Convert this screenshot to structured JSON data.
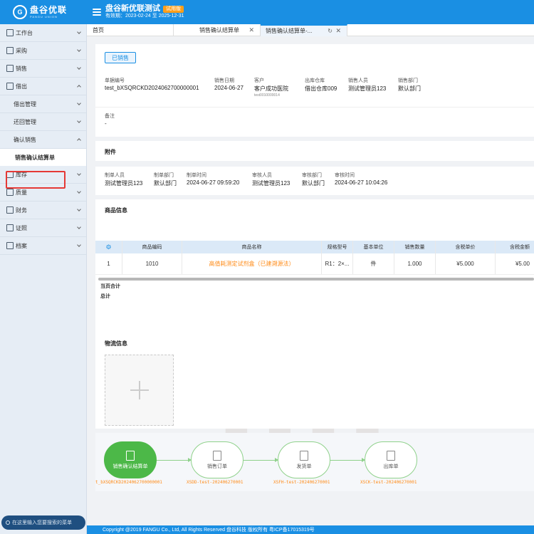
{
  "app": {
    "logo_text": "盘谷优联",
    "logo_sub": "PANGU UNION",
    "title": "盘谷新优联测试",
    "trial_badge": "试用版",
    "validity": "有效期：2023-02-24 至 2025-12-31"
  },
  "sidebar": {
    "items": [
      {
        "label": "工作台"
      },
      {
        "label": "采购"
      },
      {
        "label": "销售"
      },
      {
        "label": "借出"
      },
      {
        "label": "借出管理"
      },
      {
        "label": "还回管理"
      },
      {
        "label": "确认销售"
      },
      {
        "label": "销售确认结算单"
      },
      {
        "label": "库存"
      },
      {
        "label": "质量"
      },
      {
        "label": "财务"
      },
      {
        "label": "证照"
      },
      {
        "label": "档案"
      }
    ],
    "search_placeholder": "在这里输入您要搜索的菜单"
  },
  "tabs": {
    "home": "首页",
    "tab2": "销售确认结算单",
    "tab3": "销售确认结算单-..."
  },
  "status": "已销售",
  "header_fields": {
    "doc_no_label": "单据编号",
    "doc_no": "test_bXSQRCKD2024062700000001",
    "sale_date_label": "销售日期",
    "sale_date": "2024-06-27",
    "customer_label": "客户",
    "customer": "客户成功医院",
    "customer_code": "test0010000014",
    "warehouse_label": "出库仓库",
    "warehouse": "借出仓库009",
    "salesperson_label": "销售人员",
    "salesperson": "测试管理员123",
    "dept_label": "销售部门",
    "dept": "默认部门",
    "remark_label": "备注",
    "remark": "-"
  },
  "attachment_title": "附件",
  "audit_fields": {
    "maker_label": "制单人员",
    "maker": "测试管理员123",
    "maker_dept_label": "制单部门",
    "maker_dept": "默认部门",
    "make_time_label": "制单时间",
    "make_time": "2024-06-27 09:59:20",
    "auditor_label": "审核人员",
    "auditor": "测试管理员123",
    "audit_dept_label": "审核部门",
    "audit_dept": "默认部门",
    "audit_time_label": "审核时间",
    "audit_time": "2024-06-27 10:04:26"
  },
  "goods_title": "商品信息",
  "table": {
    "headers": [
      "商品编码",
      "商品名称",
      "规格型号",
      "基本单位",
      "销售数量",
      "含税单价",
      "含税金额"
    ],
    "row": {
      "index": "1",
      "code": "1010",
      "name": "高值耗测定试剂盒（已建溯源法）",
      "spec": "R1：2×...",
      "unit": "件",
      "qty": "1.000",
      "price": "¥5.000",
      "amount": "¥5.00"
    },
    "page_total": "当页合计",
    "total": "总计"
  },
  "logistics_title": "物流信息",
  "flow": [
    {
      "label": "销售确认结算单",
      "code": "t_bXSQRCKD2024062700000001"
    },
    {
      "label": "销售订单",
      "code": "XSDD-test-202406270001"
    },
    {
      "label": "发货单",
      "code": "XSFH-test-202406270001"
    },
    {
      "label": "出库单",
      "code": "XSCK-test-202406270001"
    }
  ],
  "footer": "Copyright @2019 FANGU Co., Ltd, All Rights Reserved 盘谷科技 版权所有    粤ICP备17015319号",
  "colors": {
    "primary": "#1a8fe3",
    "accent": "#ff8c1a",
    "flow_green": "#4cb848"
  }
}
